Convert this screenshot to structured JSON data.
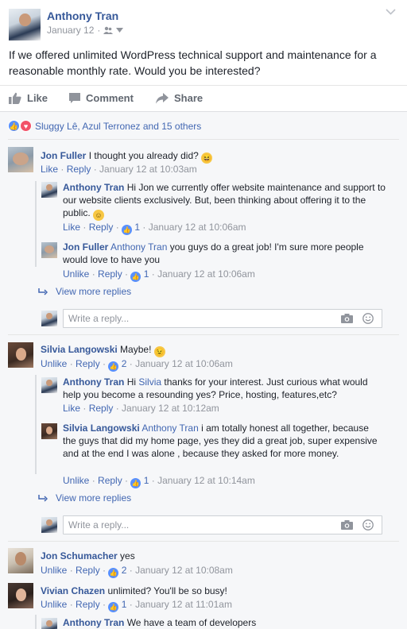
{
  "post": {
    "author": "Anthony Tran",
    "date": "January 12",
    "body": "If we offered unlimited WordPress technical support and maintenance for a reasonable monthly rate. Would you be interested?",
    "actions": {
      "like": "Like",
      "comment": "Comment",
      "share": "Share"
    },
    "reactions_text": "Sluggy Lê, Azul Terronez and 15 others"
  },
  "comments": {
    "c1": {
      "author": "Jon Fuller",
      "text": "I thought you already did?",
      "emoji": "😂",
      "like": "Like",
      "reply": "Reply",
      "time": "January 12 at 10:03am",
      "r1": {
        "author": "Anthony Tran",
        "text": "Hi Jon we currently offer website maintenance and support to our website clients exclusively. But, been thinking about offering it to the public.",
        "emoji": "🙂",
        "like": "Like",
        "reply": "Reply",
        "count": "1",
        "time": "January 12 at 10:06am"
      },
      "r2": {
        "author": "Jon Fuller",
        "mention": "Anthony Tran",
        "text": "you guys do a great job! I'm sure more people would love to have you",
        "like": "Unlike",
        "reply": "Reply",
        "count": "1",
        "time": "January 12 at 10:06am"
      },
      "more": "View more replies",
      "reply_placeholder": "Write a reply..."
    },
    "c2": {
      "author": "Silvia Langowski",
      "text": "Maybe!",
      "emoji": "😉",
      "like": "Unlike",
      "reply": "Reply",
      "count": "2",
      "time": "January 12 at 10:06am",
      "r1": {
        "author": "Anthony Tran",
        "text_pre": "Hi",
        "mention": "Silvia",
        "text": "thanks for your interest. Just curious what would help you become a resounding yes? Price, hosting, features,etc?",
        "like": "Like",
        "reply": "Reply",
        "time": "January 12 at 10:12am"
      },
      "r2": {
        "author": "Silvia Langowski",
        "mention": "Anthony Tran",
        "text": "i am totally honest all together, because the guys that did my home page, yes they did a great job, super expensive and at the end I was alone , because they asked for more money.",
        "like": "Unlike",
        "reply": "Reply",
        "count": "1",
        "time": "January 12 at 10:14am"
      },
      "more": "View more replies",
      "reply_placeholder": "Write a reply..."
    },
    "c3": {
      "author": "Jon Schumacher",
      "text": "yes",
      "like": "Unlike",
      "reply": "Reply",
      "count": "2",
      "time": "January 12 at 10:08am"
    },
    "c4": {
      "author": "Vivian Chazen",
      "text": "unlimited? You'll be so busy!",
      "like": "Unlike",
      "reply": "Reply",
      "count": "1",
      "time": "January 12 at 11:01am",
      "r1": {
        "author": "Anthony Tran",
        "text": "We have a team of developers"
      }
    }
  }
}
